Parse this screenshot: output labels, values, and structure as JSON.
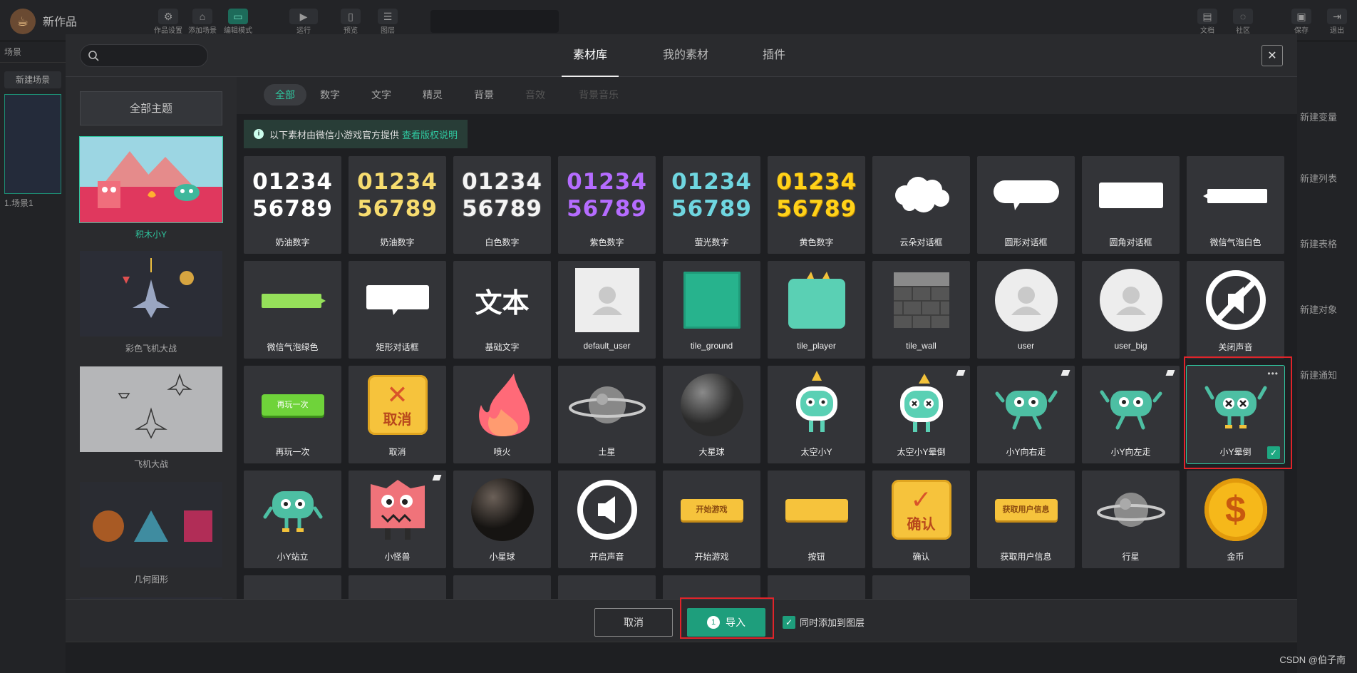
{
  "app": {
    "title": "新作品",
    "toolbar": [
      {
        "label": "作品设置",
        "icon": "gear-icon"
      },
      {
        "label": "添加场景",
        "icon": "home-icon"
      },
      {
        "label": "编辑模式",
        "icon": "monitor-icon"
      },
      {
        "label": "运行",
        "icon": "play-icon"
      },
      {
        "label": "预览",
        "icon": "phone-icon"
      },
      {
        "label": "图层",
        "icon": "list-icon"
      }
    ],
    "right_toolbar": [
      {
        "label": "文档",
        "icon": "book-icon"
      },
      {
        "label": "社区",
        "icon": "chat-icon"
      },
      {
        "label": "保存",
        "icon": "save-icon"
      },
      {
        "label": "退出",
        "icon": "exit-icon"
      }
    ],
    "left_panel": {
      "title": "场景",
      "new_scene": "新建场景",
      "scene_label": "1.场景1"
    },
    "right_panel": [
      "新建变量",
      "新建列表",
      "新建表格",
      "新建对象",
      "新建通知"
    ],
    "watermark": "CSDN @伯子南"
  },
  "modal": {
    "search_placeholder": "",
    "tabs": [
      "素材库",
      "我的素材",
      "插件"
    ],
    "active_tab": "素材库",
    "sidebar": {
      "all_themes": "全部主题",
      "themes": [
        "积木小Y",
        "彩色飞机大战",
        "飞机大战",
        "几何图形"
      ]
    },
    "subtabs": [
      {
        "label": "全部",
        "state": "active"
      },
      {
        "label": "数字",
        "state": "normal"
      },
      {
        "label": "文字",
        "state": "normal"
      },
      {
        "label": "精灵",
        "state": "normal"
      },
      {
        "label": "背景",
        "state": "normal"
      },
      {
        "label": "音效",
        "state": "disabled"
      },
      {
        "label": "背景音乐",
        "state": "disabled"
      }
    ],
    "notice": {
      "text": "以下素材由微信小游戏官方提供",
      "link": "查看版权说明"
    },
    "assets": [
      [
        "奶油数字",
        "奶油数字",
        "白色数字",
        "紫色数字",
        "萤光数字",
        "黄色数字",
        "云朵对话框",
        "圆形对话框",
        "圆角对话框",
        "微信气泡白色"
      ],
      [
        "微信气泡绿色",
        "矩形对话框",
        "基础文字",
        "default_user",
        "tile_ground",
        "tile_player",
        "tile_wall",
        "user",
        "user_big",
        "关闭声音"
      ],
      [
        "再玩一次",
        "取消",
        "喷火",
        "土星",
        "大星球",
        "太空小Y",
        "太空小Y晕倒",
        "小Y向右走",
        "小Y向左走",
        "小Y晕倒"
      ],
      [
        "小Y站立",
        "小怪兽",
        "小星球",
        "开启声音",
        "开始游戏",
        "按钮",
        "确认",
        "获取用户信息",
        "行星",
        "金币"
      ]
    ],
    "art_text": {
      "digits_top": "01234",
      "digits_bottom": "56789",
      "text_sample": "文本",
      "replay": "再玩一次",
      "cancel": "取消",
      "confirm": "确认",
      "start": "开始游戏",
      "get_user": "获取用户信息",
      "coin": "$"
    },
    "colors": {
      "accent": "#2fc8a0",
      "highlight": "#e0242a",
      "cream_digits": "#ffffff",
      "cream2_digits": "#f7dc6f",
      "purple_digits": "#b56cff",
      "fluor_digits": "#6fd6e0",
      "yellow_digits": "#ffd21a"
    },
    "selected_asset": "小Y晕倒",
    "footer": {
      "cancel": "取消",
      "import": "导入",
      "import_count": "1",
      "add_to_layer": "同时添加到图层",
      "add_to_layer_checked": true
    }
  }
}
